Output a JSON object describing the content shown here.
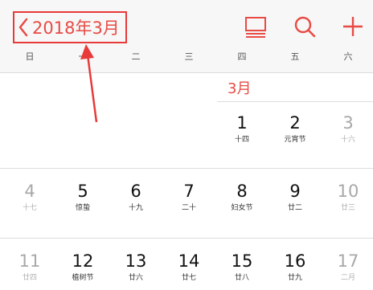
{
  "header": {
    "back_label": "2018年3月",
    "icons": [
      "calendar-list-icon",
      "search-icon",
      "plus-icon"
    ]
  },
  "colors": {
    "accent": "#e84b45",
    "highlight_border": "#e83a3a"
  },
  "weekdays": [
    "日",
    "一",
    "二",
    "三",
    "四",
    "五",
    "六"
  ],
  "month_label": "3月",
  "weeks": [
    [
      {
        "num": "1",
        "lunar": "十四"
      },
      {
        "num": "2",
        "lunar": "元宵节"
      },
      {
        "num": "3",
        "lunar": "十六"
      }
    ],
    [
      {
        "num": "4",
        "lunar": "十七"
      },
      {
        "num": "5",
        "lunar": "惊蛰"
      },
      {
        "num": "6",
        "lunar": "十九"
      },
      {
        "num": "7",
        "lunar": "二十"
      },
      {
        "num": "8",
        "lunar": "妇女节"
      },
      {
        "num": "9",
        "lunar": "廿二"
      },
      {
        "num": "10",
        "lunar": "廿三"
      }
    ],
    [
      {
        "num": "11",
        "lunar": "廿四"
      },
      {
        "num": "12",
        "lunar": "植树节"
      },
      {
        "num": "13",
        "lunar": "廿六"
      },
      {
        "num": "14",
        "lunar": "廿七"
      },
      {
        "num": "15",
        "lunar": "廿八"
      },
      {
        "num": "16",
        "lunar": "廿九"
      },
      {
        "num": "17",
        "lunar": "二月"
      }
    ]
  ]
}
